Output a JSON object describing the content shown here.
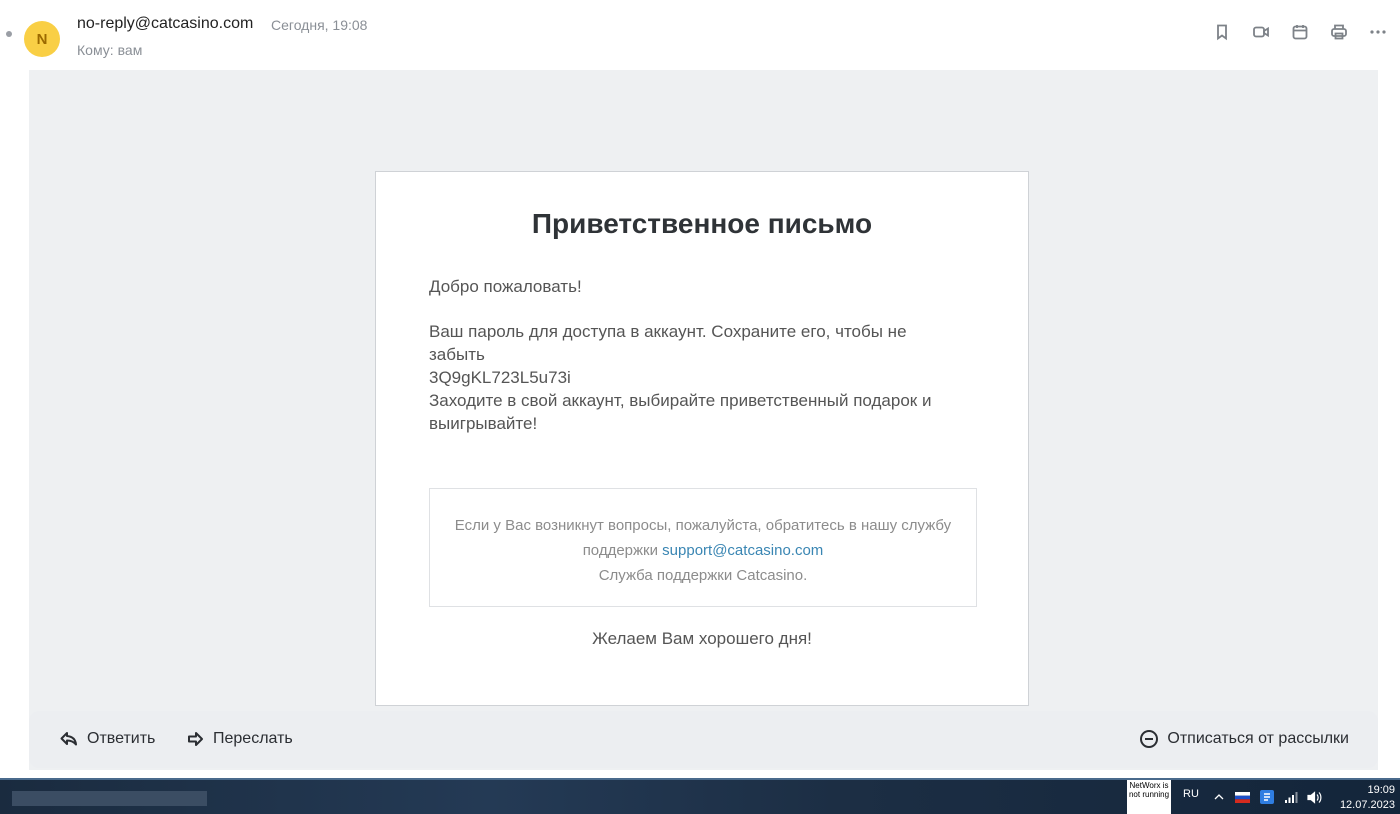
{
  "header": {
    "avatar_letter": "N",
    "sender": "no-reply@catcasino.com",
    "date": "Сегодня, 19:08",
    "to_label": "Кому:",
    "to_value": "вам",
    "icons": [
      "bookmark-icon",
      "video-icon",
      "calendar-icon",
      "print-icon",
      "more-icon"
    ]
  },
  "letter": {
    "title": "Приветственное письмо",
    "greeting": "Добро пожаловать!",
    "password_intro": "Ваш пароль для доступа в аккаунт. Сохраните его, чтобы не забыть",
    "password": "3Q9gKL723L5u73i",
    "call_to_action": "Заходите в свой аккаунт, выбирайте приветственный подарок и выигрывайте!",
    "support": {
      "text": "Если у Вас возникнут вопросы, пожалуйста, обратитесь в нашу службу поддержки",
      "email": "support@catcasino.com",
      "signature": "Служба поддержки Catcasino."
    },
    "farewell": "Желаем Вам хорошего дня!"
  },
  "actions": {
    "reply": "Ответить",
    "forward": "Переслать",
    "unsubscribe": "Отписаться от рассылки"
  },
  "taskbar": {
    "networx": "NetWorx is not running",
    "language": "RU",
    "time": "19:09",
    "date": "12.07.2023"
  },
  "colors": {
    "avatar": "#f9cf45",
    "link": "#3a86b3",
    "canvas": "#eef0f2"
  }
}
